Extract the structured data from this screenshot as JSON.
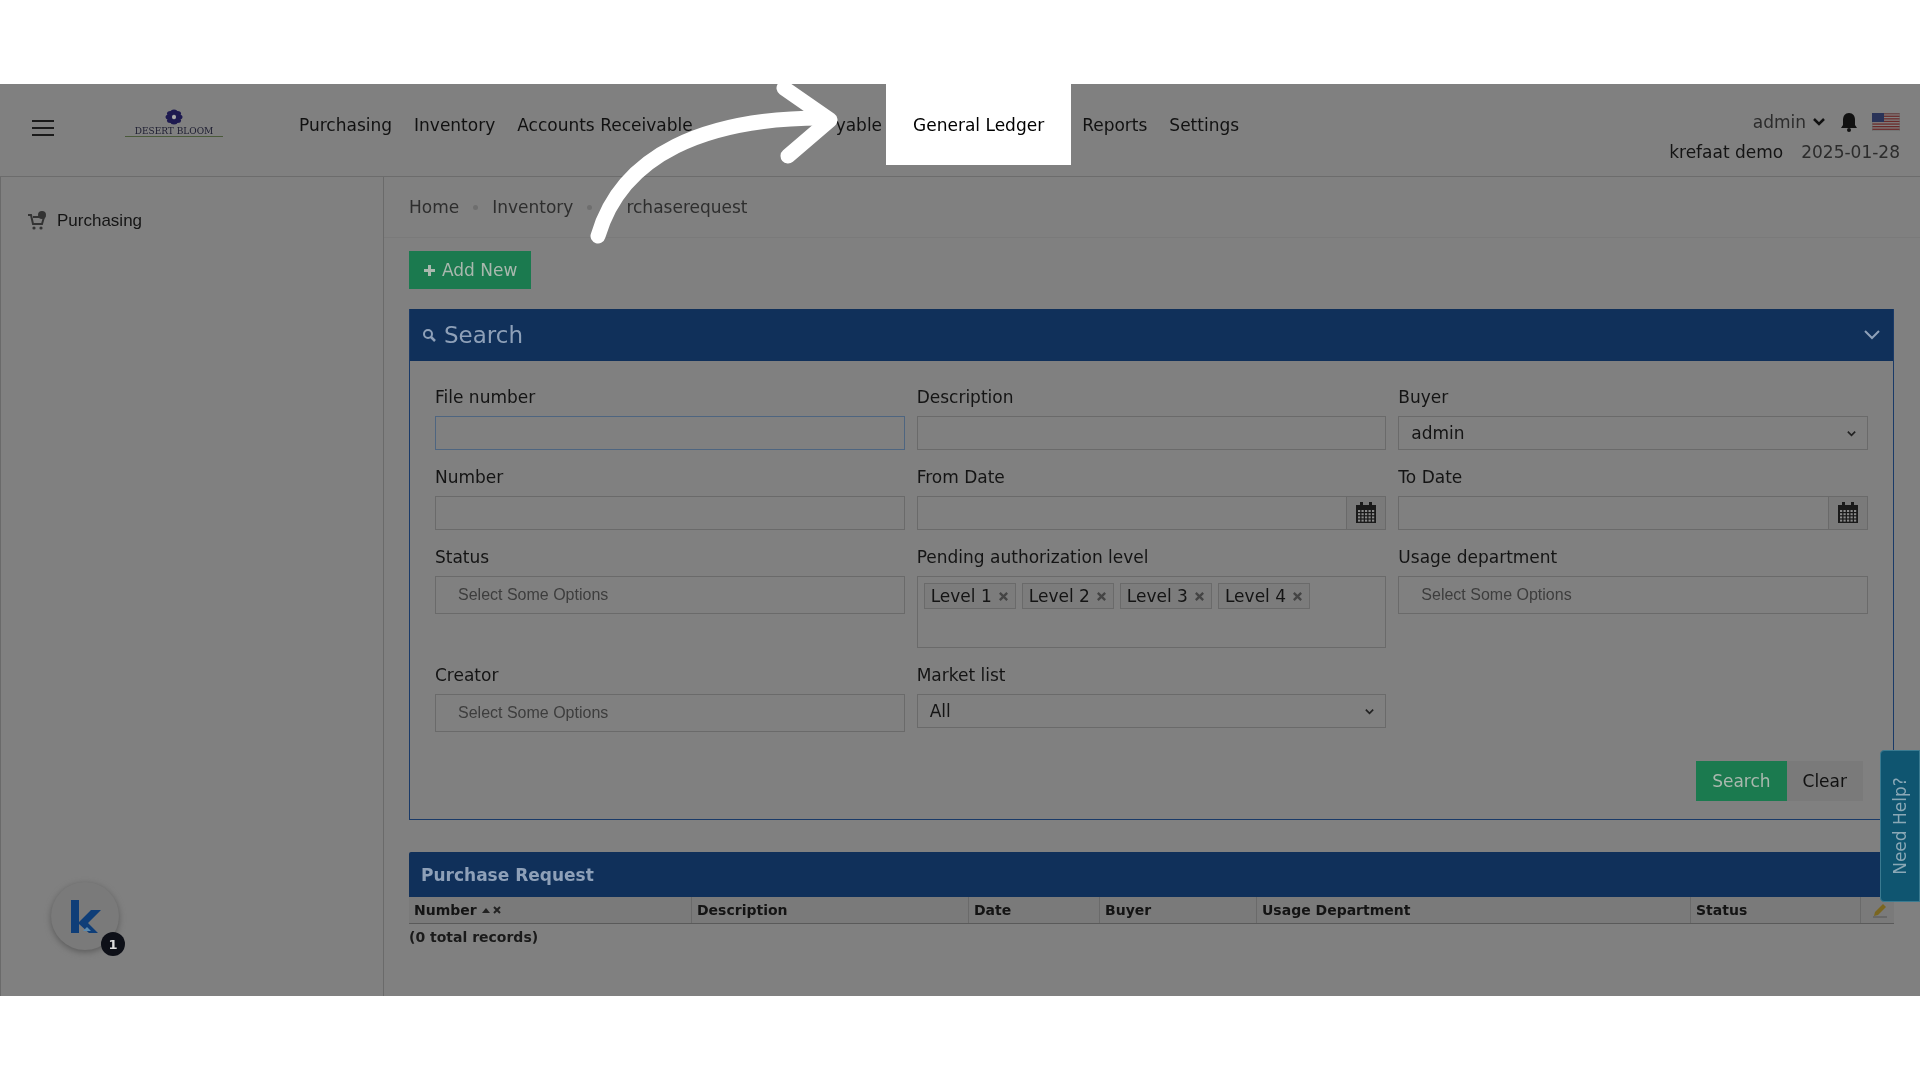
{
  "header": {
    "logo_text": "DESERT BLOOM",
    "nav": [
      {
        "label": "Purchasing",
        "highlighted": false
      },
      {
        "label": "Inventory",
        "highlighted": false
      },
      {
        "label": "Accounts Receivable",
        "highlighted": false
      },
      {
        "label": "yable",
        "highlighted": false
      },
      {
        "label": "General Ledger",
        "highlighted": true
      },
      {
        "label": "Reports",
        "highlighted": false
      },
      {
        "label": "Settings",
        "highlighted": false
      }
    ],
    "user": "admin",
    "company": "krefaat demo",
    "date": "2025-01-28"
  },
  "sidebar": {
    "items": [
      {
        "label": "Purchasing",
        "selected": false
      }
    ],
    "chat_badge": "1"
  },
  "breadcrumb": [
    "Home",
    "Inventory",
    "rchaserequest"
  ],
  "add_button": "Add New",
  "search_panel": {
    "title": "Search",
    "fields": [
      {
        "label": "File number",
        "kind": "text"
      },
      {
        "label": "Description",
        "kind": "text"
      },
      {
        "label": "Buyer",
        "kind": "select",
        "value": "admin"
      },
      {
        "label": "Number",
        "kind": "text"
      },
      {
        "label": "From Date",
        "kind": "date"
      },
      {
        "label": "To Date",
        "kind": "date"
      },
      {
        "label": "Status",
        "kind": "multi",
        "placeholder": "Select Some Options"
      },
      {
        "label": "Pending authorization level",
        "kind": "tags",
        "tags": [
          "Level 1",
          "Level 2",
          "Level 3",
          "Level 4"
        ]
      },
      {
        "label": "Usage department",
        "kind": "multi",
        "placeholder": "Select Some Options"
      },
      {
        "label": "Creator",
        "kind": "multi",
        "placeholder": "Select Some Options"
      },
      {
        "label": "Market list",
        "kind": "select",
        "value": "All"
      }
    ],
    "buttons": [
      {
        "label": "Search",
        "kind": "primary"
      },
      {
        "label": "Clear",
        "kind": "plain"
      }
    ]
  },
  "help_tab": "Need Help?",
  "table": {
    "title": "Purchase Request",
    "columns": [
      "Number",
      "Description",
      "Date",
      "Buyer",
      "Usage Department",
      "Status"
    ],
    "footer": "(0 total records)"
  }
}
